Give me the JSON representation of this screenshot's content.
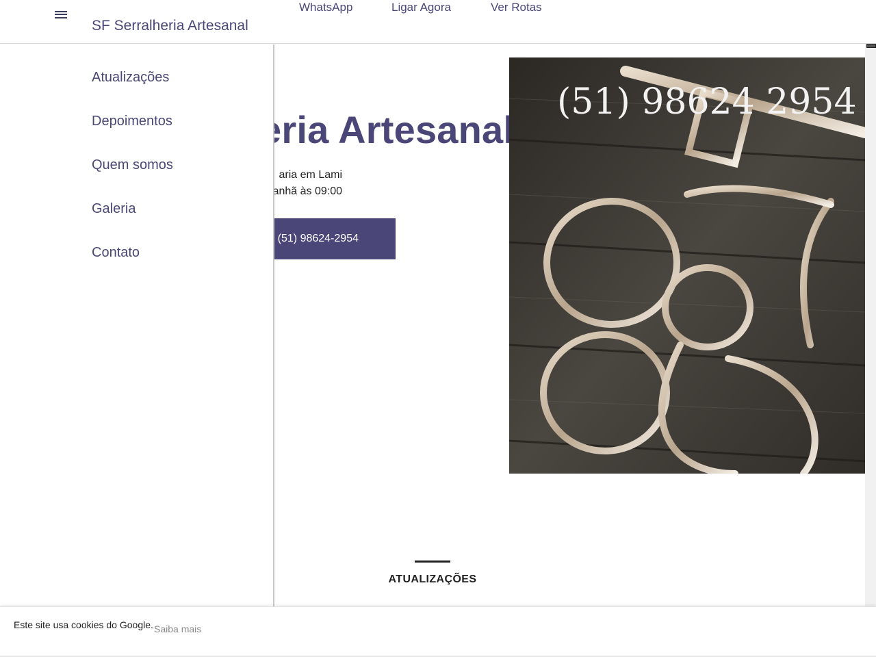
{
  "header": {
    "site_title": "SF Serralheria Artesanal",
    "menu_icon": "hamburger-menu-icon",
    "nav": [
      {
        "label": "WhatsApp"
      },
      {
        "label": "Ligar Agora"
      },
      {
        "label": "Ver Rotas"
      }
    ]
  },
  "hero": {
    "title_visible": "eria Artesanal",
    "subtitle_line1": "aria em Lami",
    "subtitle_line2": "anhã às 09:00",
    "cta_text": "↗ (51) 98624-2954",
    "image_overlay_text": "(51) 98624 2954"
  },
  "drawer": {
    "items": [
      {
        "label": "Atualizações"
      },
      {
        "label": "Depoimentos"
      },
      {
        "label": "Quem somos"
      },
      {
        "label": "Galeria"
      },
      {
        "label": "Contato"
      }
    ]
  },
  "section": {
    "title": "ATUALIZAÇÕES"
  },
  "cookie": {
    "text": "Este site usa cookies do Google.",
    "link": "Saiba mais"
  },
  "colors": {
    "brand": "#4a4778",
    "text": "#212121",
    "muted": "#8a8a8a"
  }
}
